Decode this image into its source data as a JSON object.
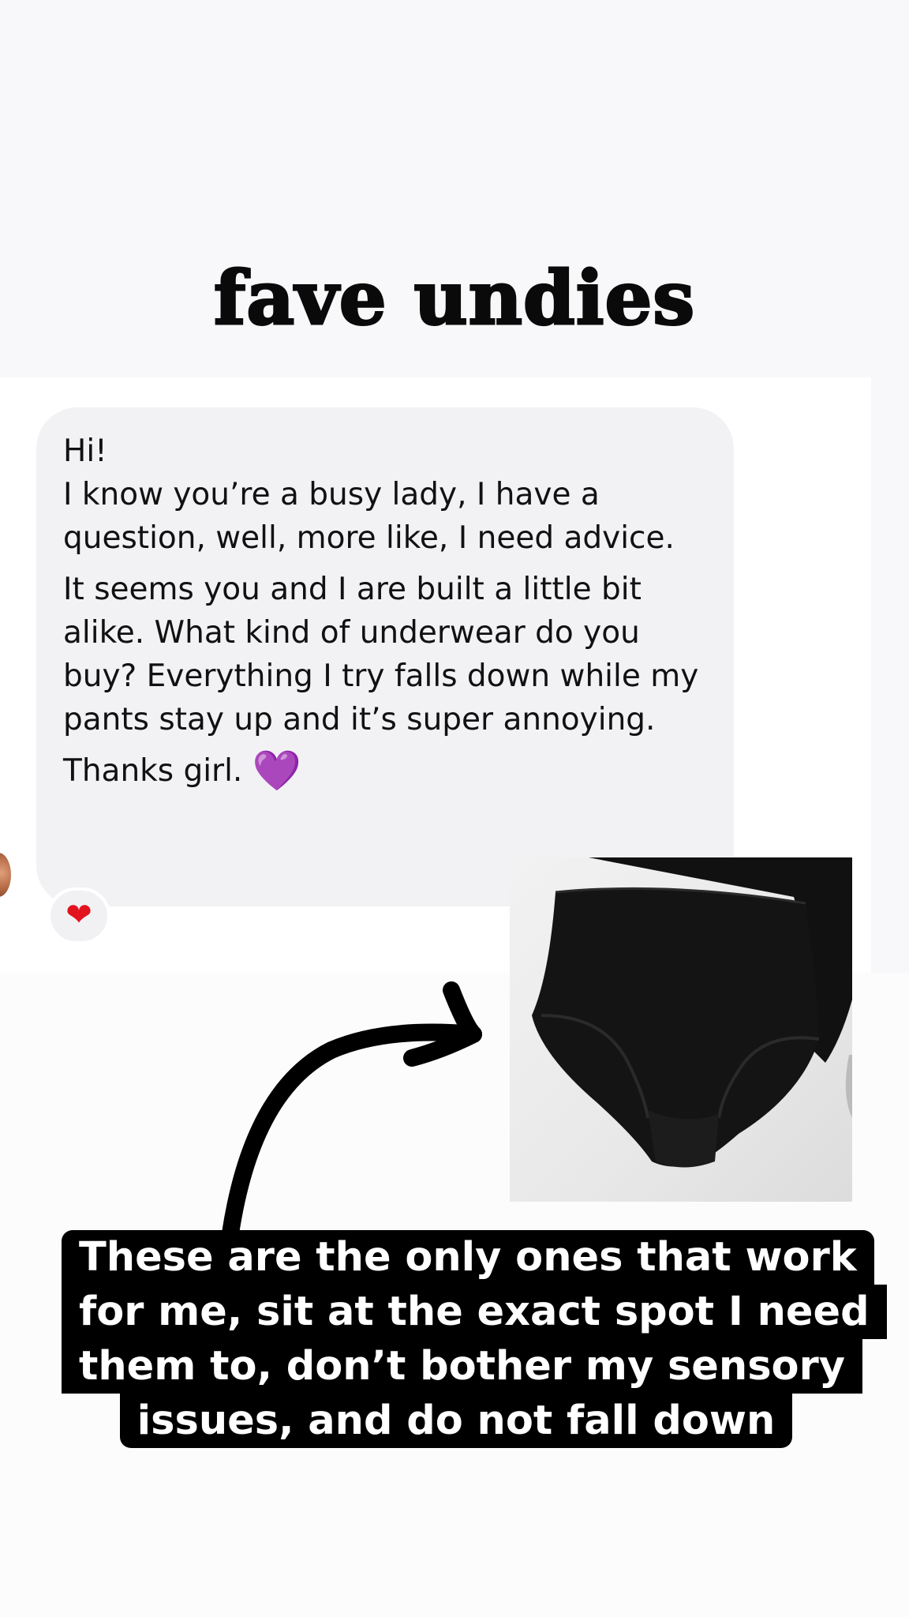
{
  "story": {
    "title": "fave undies",
    "caption_lines": [
      "These are the only ones that work",
      "for me, sit at the exact spot I need",
      "them to, don’t bother my sensory",
      "issues, and do not fall down"
    ]
  },
  "message": {
    "lines": [
      "Hi!",
      "I know you’re a busy lady, I have a",
      "question, well, more like, I need advice.",
      "",
      "It seems you and I are built a little bit",
      "alike. What kind of underwear do you",
      "buy? Everything I try falls down while my",
      "pants stay up and it’s super annoying.",
      "",
      "Thanks girl."
    ],
    "closing_emoji": "💜",
    "reaction_emoji": "❤"
  },
  "icons": {
    "purple_heart": "purple-heart-icon",
    "red_heart": "red-heart-icon",
    "arrow": "curved-arrow-icon"
  },
  "colors": {
    "title": "#0a0a0a",
    "bubble": "#f2f2f5",
    "caption_bg": "#000000",
    "caption_text": "#ffffff",
    "purple_heart": "#8a2be2",
    "red_heart": "#e3121f"
  }
}
